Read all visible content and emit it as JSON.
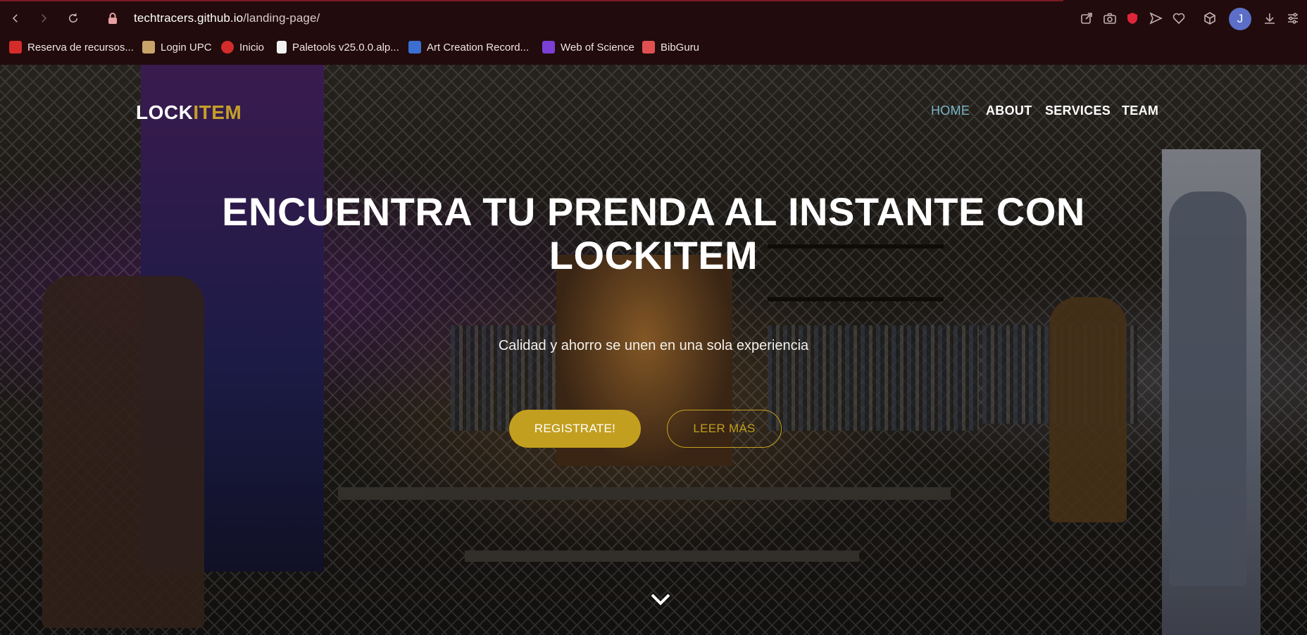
{
  "browser": {
    "url_host": "techtracers.github.io",
    "url_path": "/landing-page/",
    "avatar_initial": "J",
    "bookmarks": [
      {
        "label": "Reserva de recursos...",
        "color": "#d42b2b"
      },
      {
        "label": "Login UPC",
        "color": "#c8a46a"
      },
      {
        "label": "Inicio",
        "color": "#d42b2b"
      },
      {
        "label": "Paletools v25.0.0.alp...",
        "color": "#f2f2f2"
      },
      {
        "label": "Art Creation Record...",
        "color": "#3b6fd1"
      },
      {
        "label": "Web of Science",
        "color": "#7b3fd6"
      },
      {
        "label": "BibGuru",
        "color": "#e05050"
      }
    ]
  },
  "site": {
    "logo_main": "LOCK",
    "logo_accent": "ITEM",
    "nav": [
      {
        "label": "HOME",
        "active": true
      },
      {
        "label": "ABOUT",
        "active": false
      },
      {
        "label": "SERVICES",
        "active": false
      },
      {
        "label": "TEAM",
        "active": false
      }
    ],
    "hero": {
      "title_line1": "ENCUENTRA TU PRENDA AL INSTANTE CON",
      "title_line2": "LOCKITEM",
      "subtitle": "Calidad y ahorro se unen en una sola experiencia",
      "primary_button": "REGISTRATE!",
      "secondary_button": "LEER MÁS"
    },
    "colors": {
      "accent": "#c39f1f",
      "nav_active": "#79b6c6"
    }
  }
}
